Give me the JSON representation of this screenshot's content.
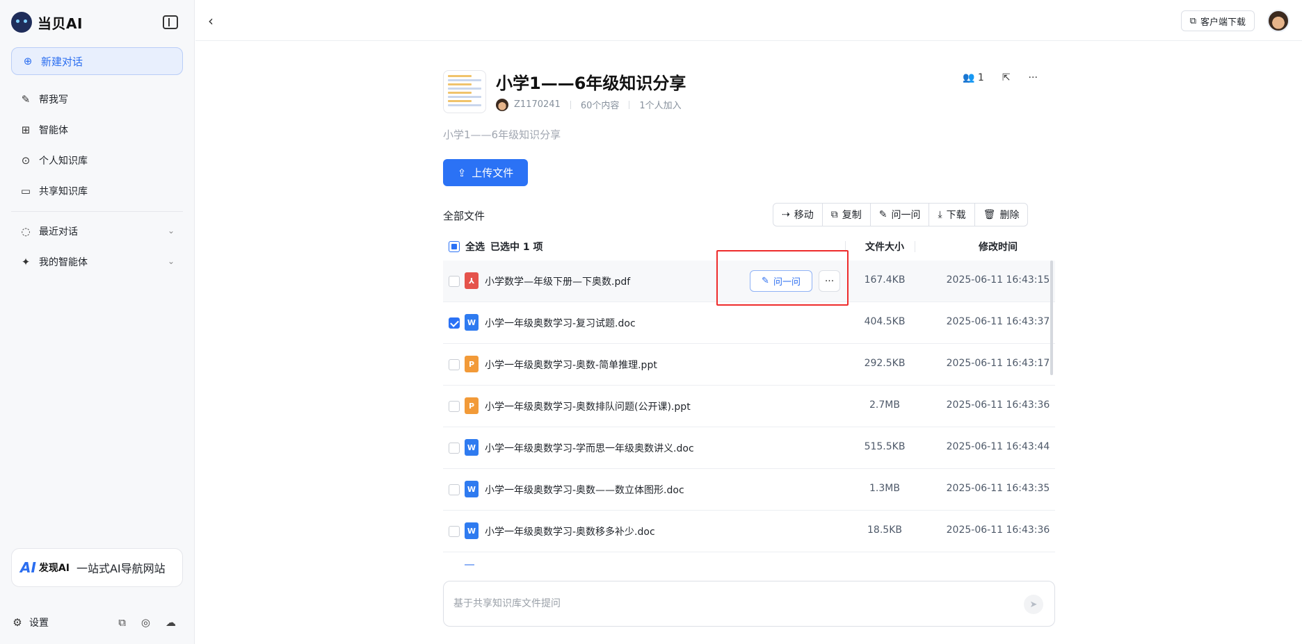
{
  "brand": {
    "name": "当贝AI"
  },
  "sidebar": {
    "new_chat": "新建对话",
    "items": [
      {
        "label": "帮我写",
        "icon": "pen-icon"
      },
      {
        "label": "智能体",
        "icon": "grid-icon"
      },
      {
        "label": "个人知识库",
        "icon": "upload-circle-icon"
      },
      {
        "label": "共享知识库",
        "icon": "folder-share-icon"
      }
    ],
    "groups": [
      {
        "label": "最近对话",
        "icon": "chat-bubble-icon"
      },
      {
        "label": "我的智能体",
        "icon": "sparkle-icon"
      }
    ],
    "promo": {
      "logo_ai": "AI",
      "logo_name": "发现AI",
      "text": "一站式AI导航网站"
    },
    "settings": "设置"
  },
  "topbar": {
    "client_download": "客户端下载"
  },
  "kb": {
    "title": "小学1——6年级知识分享",
    "owner": "Z1170241",
    "content_count": "60个内容",
    "members_joined": "1个人加入",
    "member_count": "1",
    "description": "小学1——6年级知识分享"
  },
  "upload_label": "上传文件",
  "files_label": "全部文件",
  "toolbar": {
    "move": "移动",
    "copy": "复制",
    "ask": "问一问",
    "download": "下载",
    "delete": "删除"
  },
  "table": {
    "select_all": "全选",
    "selected_info": "已选中 1 项",
    "col_size": "文件大小",
    "col_time": "修改时间",
    "row_ask": "问一问",
    "rows": [
      {
        "name": "小学数学—年级下册—下奥数.pdf",
        "type": "pdf",
        "size": "167.4KB",
        "time": "2025-06-11 16:43:15",
        "checked": false
      },
      {
        "name": "小学一年级奥数学习-复习试题.doc",
        "type": "doc",
        "size": "404.5KB",
        "time": "2025-06-11 16:43:37",
        "checked": true
      },
      {
        "name": "小学一年级奥数学习-奥数-简单推理.ppt",
        "type": "ppt",
        "size": "292.5KB",
        "time": "2025-06-11 16:43:17",
        "checked": false
      },
      {
        "name": "小学一年级奥数学习-奥数排队问题(公开课).ppt",
        "type": "ppt",
        "size": "2.7MB",
        "time": "2025-06-11 16:43:36",
        "checked": false
      },
      {
        "name": "小学一年级奥数学习-学而思一年级奥数讲义.doc",
        "type": "doc",
        "size": "515.5KB",
        "time": "2025-06-11 16:43:44",
        "checked": false
      },
      {
        "name": "小学一年级奥数学习-奥数——数立体图形.doc",
        "type": "doc",
        "size": "1.3MB",
        "time": "2025-06-11 16:43:35",
        "checked": false
      },
      {
        "name": "小学一年级奥数学习-奥数移多补少.doc",
        "type": "doc",
        "size": "18.5KB",
        "time": "2025-06-11 16:43:36",
        "checked": false
      }
    ]
  },
  "composer": {
    "placeholder": "基于共享知识库文件提问"
  },
  "colors": {
    "accent": "#2b72f5",
    "highlight": "#ee2b2b"
  }
}
